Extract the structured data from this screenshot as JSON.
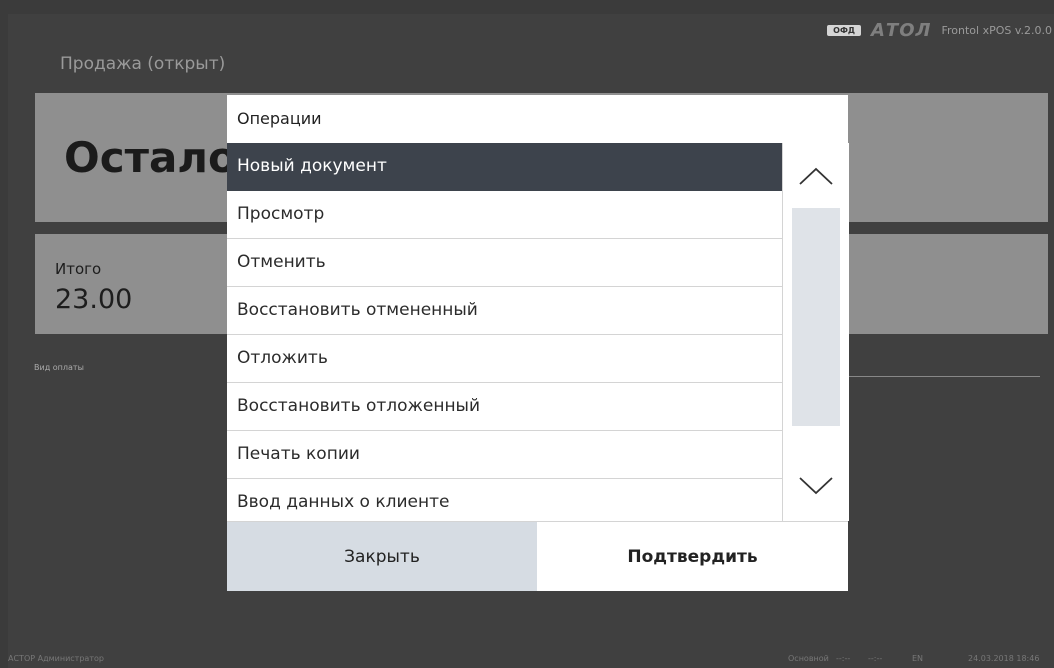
{
  "header": {
    "ofd_badge": "ОФД",
    "brand_logo": "АТОЛ",
    "app_version": "Frontol xPOS v.2.0.0"
  },
  "screen": {
    "title": "Продажа (открыт)",
    "remaining_label": "Осталось",
    "total_label": "Итого",
    "total_value": "23.00",
    "payment_type_label": "Вид оплаты"
  },
  "dialog": {
    "title": "Операции",
    "items": [
      {
        "label": "Новый документ",
        "selected": true
      },
      {
        "label": "Просмотр"
      },
      {
        "label": "Отменить"
      },
      {
        "label": "Восстановить отмененный"
      },
      {
        "label": "Отложить"
      },
      {
        "label": "Восстановить отложенный"
      },
      {
        "label": "Печать копии"
      },
      {
        "label": "Ввод данных о клиенте"
      }
    ],
    "close_label": "Закрыть",
    "confirm_label": "Подтвердить"
  },
  "statusbar": {
    "user": "АСТОР  Администратор",
    "profile": "Основной",
    "indicator1": "--:--",
    "indicator2": "--:--",
    "language": "EN",
    "datetime": "24.03.2018 18:46"
  },
  "colors": {
    "selected_row": "#3d434c",
    "close_button": "#d6dce3",
    "background": "#404040",
    "panel": "#8f8f8f"
  }
}
